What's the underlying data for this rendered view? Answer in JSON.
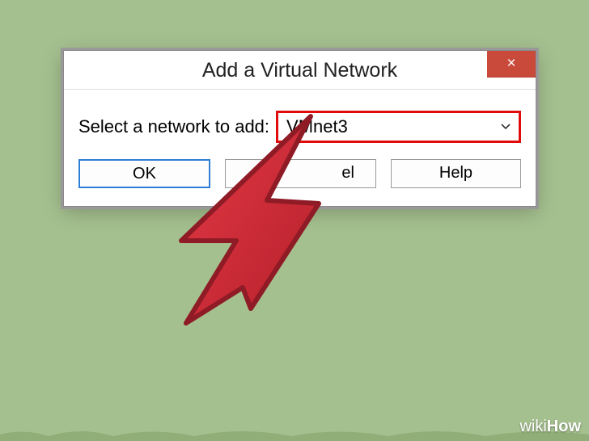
{
  "dialog": {
    "title": "Add a Virtual Network",
    "close_symbol": "×",
    "label": "Select a network to add:",
    "dropdown": {
      "value": "VMnet3"
    },
    "buttons": {
      "ok": "OK",
      "cancel": "el",
      "help": "Help"
    }
  },
  "colors": {
    "highlight_border": "#e10b0b",
    "close_bg": "#c94a3b",
    "cursor_fill": "#cf2731",
    "cursor_stroke": "#8e1b25",
    "background": "#a5c08f"
  },
  "watermark": {
    "prefix": "wiki",
    "suffix": "How"
  }
}
